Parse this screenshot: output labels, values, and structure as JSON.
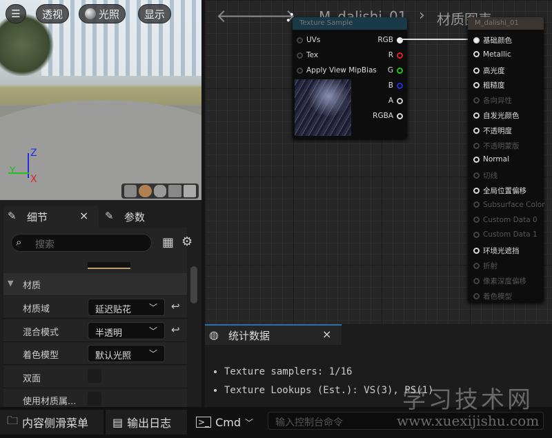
{
  "viewport": {
    "menu_icon": "hamburger-icon",
    "perspective": "透视",
    "lighting": "光照",
    "show": "显示",
    "axis_z": "Z",
    "axis_y": "Y",
    "axis_x": "X"
  },
  "graph": {
    "breadcrumb_asset": "M_dalishi_01",
    "breadcrumb_sep": "›",
    "breadcrumb_page": "材质图表",
    "texture_node": {
      "title": "Texture Sample",
      "inputs": [
        "UVs",
        "Tex",
        "Apply View MipBias"
      ],
      "outputs": [
        "RGB",
        "R",
        "G",
        "B",
        "A",
        "RGBA"
      ],
      "output_colors": [
        "#eeeeee",
        "#e02020",
        "#20c020",
        "#2030e0",
        "#cccccc",
        "#dddddd"
      ]
    },
    "material_node": {
      "title": "M_dalishi_01",
      "pins": [
        {
          "label": "基础颜色",
          "enabled": true,
          "connected": true
        },
        {
          "label": "Metallic",
          "enabled": true
        },
        {
          "label": "高光度",
          "enabled": true
        },
        {
          "label": "粗糙度",
          "enabled": true
        },
        {
          "label": "各向异性",
          "enabled": false
        },
        {
          "label": "自发光颜色",
          "enabled": true
        },
        {
          "label": "不透明度",
          "enabled": true
        },
        {
          "label": "不透明蒙版",
          "enabled": false
        },
        {
          "label": "Normal",
          "enabled": true
        },
        {
          "label": "切线",
          "enabled": false
        },
        {
          "label": "全局位置偏移",
          "enabled": true
        },
        {
          "label": "Subsurface Color",
          "enabled": false
        },
        {
          "label": "Custom Data 0",
          "enabled": false
        },
        {
          "label": "Custom Data 1",
          "enabled": false
        },
        {
          "label": "环境光遮挡",
          "enabled": true
        },
        {
          "label": "折射",
          "enabled": false
        },
        {
          "label": "像素深度偏移",
          "enabled": false
        },
        {
          "label": "着色模型",
          "enabled": false
        }
      ]
    }
  },
  "details": {
    "tab_details": "细节",
    "tab_params": "参数",
    "close": "×",
    "search_placeholder": "搜索",
    "section": "材质",
    "rows": [
      {
        "label": "材质域",
        "value": "延迟贴花"
      },
      {
        "label": "混合模式",
        "value": "半透明"
      },
      {
        "label": "着色模型",
        "value": "默认光照"
      },
      {
        "label": "双面"
      },
      {
        "label": "使用材质属..."
      }
    ]
  },
  "stats": {
    "title": "统计数据",
    "close": "×",
    "lines": [
      "Texture samplers: 1/16",
      "Texture Lookups (Est.): VS(3), PS(1)"
    ]
  },
  "bottom": {
    "content_drawer": "内容侧滑菜单",
    "output_log": "输出日志",
    "cmd": "Cmd",
    "console_placeholder": "输入控制台命令"
  },
  "watermark": {
    "title": "学习技术网",
    "url": "www.xuexijishu.com"
  }
}
